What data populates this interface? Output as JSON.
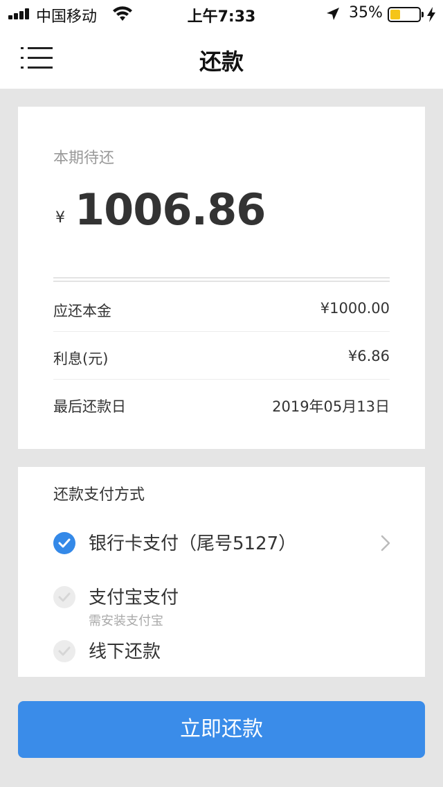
{
  "status_bar": {
    "carrier": "中国移动",
    "time": "上午7:33",
    "battery_percent_label": "35%",
    "battery_level": 0.35,
    "colors": {
      "battery_fill": "#f5c518"
    }
  },
  "nav": {
    "title": "还款",
    "menu_icon": "menu-icon"
  },
  "due": {
    "label": "本期待还",
    "currency_symbol": "¥",
    "amount": "1006.86",
    "rows": [
      {
        "key": "应还本金",
        "value": "¥1000.00"
      },
      {
        "key": "利息(元)",
        "value": "¥6.86"
      },
      {
        "key": "最后还款日",
        "value": "2019年05月13日"
      }
    ]
  },
  "payment": {
    "title": "还款支付方式",
    "options": [
      {
        "label": "银行卡支付（尾号5127）",
        "sub": "",
        "selected": true
      },
      {
        "label": "支付宝支付",
        "sub": "需安装支付宝",
        "selected": false
      },
      {
        "label": "线下还款",
        "sub": "",
        "selected": false
      }
    ]
  },
  "pay_button": {
    "label": "立即还款"
  },
  "colors": {
    "accent": "#3a8ce9",
    "background": "#e5e5e5",
    "muted_text": "#999999"
  }
}
